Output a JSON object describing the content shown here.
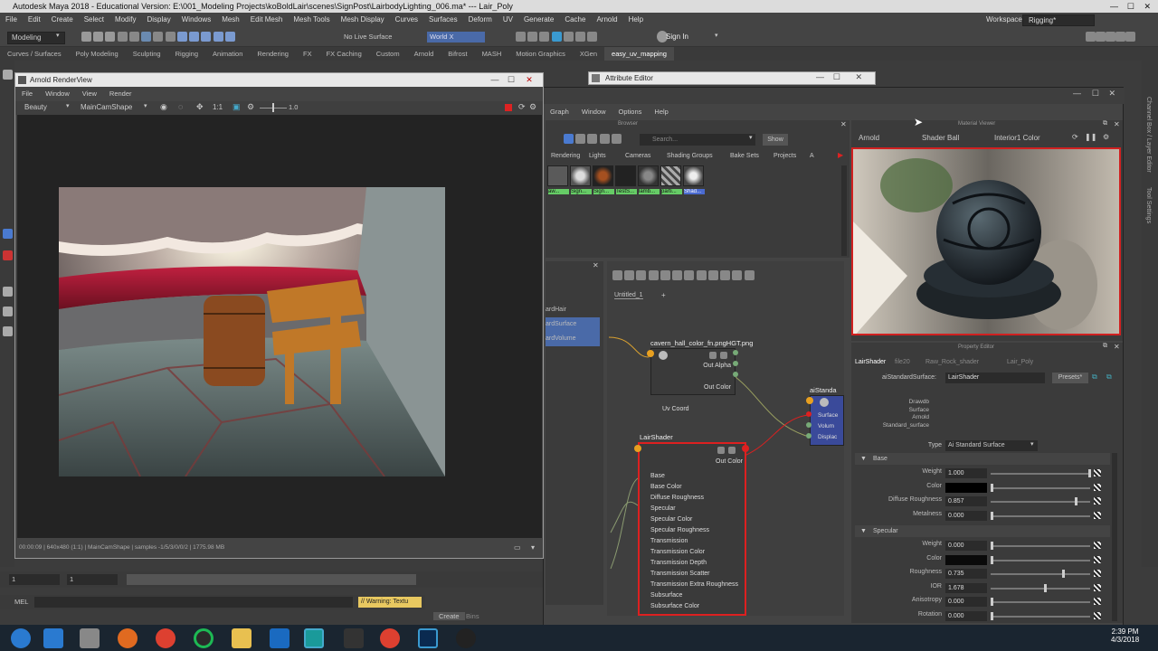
{
  "title_bar": {
    "text": "Autodesk Maya 2018 - Educational Version: E:\\001_Modeling Projects\\koBoldLair\\scenes\\SignPost\\LairbodyLighting_006.ma* --- Lair_Poly"
  },
  "menubar": [
    "File",
    "Edit",
    "Create",
    "Select",
    "Modify",
    "Display",
    "Windows",
    "Mesh",
    "Edit Mesh",
    "Mesh Tools",
    "Mesh Display",
    "Curves",
    "Surfaces",
    "Deform",
    "UV",
    "Generate",
    "Cache",
    "Arnold",
    "Help"
  ],
  "workspace": {
    "label": "Workspace :",
    "value": "Rigging*"
  },
  "toolbar": {
    "mode": "Modeling",
    "live_surface": "No Live Surface",
    "world": "World X",
    "sign_in": "Sign In"
  },
  "shelf_tabs": [
    "Curves / Surfaces",
    "Poly Modeling",
    "Sculpting",
    "Rigging",
    "Animation",
    "Rendering",
    "FX",
    "FX Caching",
    "Custom",
    "Arnold",
    "Bifrost",
    "MASH",
    "Motion Graphics",
    "XGen",
    "easy_uv_mapping"
  ],
  "shelf_active": "easy_uv_mapping",
  "render_view": {
    "title": "Arnold RenderView",
    "menu": [
      "File",
      "Window",
      "View",
      "Render"
    ],
    "aov": "Beauty",
    "camera": "MainCamShape",
    "ratio": "1:1",
    "exposure": "1.0",
    "status": "00:00:09 | 640x480 (1:1) | MainCamShape | samples -1/5/3/0/0/2 | 1775.98 MB"
  },
  "attribute_editor": {
    "title": "Attribute Editor"
  },
  "hypershade": {
    "menu": [
      "Graph",
      "Window",
      "Options",
      "Help"
    ],
    "browser_label": "Browser",
    "search_placeholder": "Search...",
    "show_button": "Show",
    "tabs": [
      "Rendering",
      "Lights",
      "Cameras",
      "Shading Groups",
      "Bake Sets",
      "Projects",
      "A"
    ],
    "swatches": [
      "aw...",
      "Sign...",
      "Sign...",
      "TestS...",
      "lamb...",
      "parti...",
      "Shad..."
    ],
    "side_items": [
      "ardHair",
      "ardSurface",
      "ardVolume"
    ],
    "graph_tab": "Untitled_1",
    "bottom_tabs": [
      "Create",
      "Bins"
    ]
  },
  "file_node": {
    "title": "cavern_hall_color_fn.pngHGT.png",
    "ports": [
      "Out Alpha",
      "Out Color",
      "Uv Coord"
    ]
  },
  "lair_node": {
    "title": "LairShader",
    "out": "Out Color",
    "ports": [
      "Base",
      "Base Color",
      "Diffuse Roughness",
      "Specular",
      "Specular Color",
      "Specular Roughness",
      "Transmission",
      "Transmission Color",
      "Transmission Depth",
      "Transmission Scatter",
      "Transmission Extra Roughness",
      "Subsurface",
      "Subsurface Color"
    ]
  },
  "ai_node": {
    "title": "aiStanda",
    "ports": [
      "Surface",
      "Volum",
      "Displac"
    ]
  },
  "material_viewer": {
    "label": "Material Viewer",
    "renderer": "Arnold",
    "geometry": "Shader Ball",
    "env": "Interior1 Color"
  },
  "property_editor": {
    "label": "Property Editor",
    "tabs": [
      "LairShader",
      "file20",
      "Raw_Rock_shader",
      "Lair_Poly"
    ],
    "node_label": "aiStandardSurface:",
    "node_name": "LairShader",
    "presets": "Presets*",
    "drawdb": [
      "Drawdb",
      "Surface",
      "Arnold",
      "Standard_surface"
    ],
    "type_label": "Type",
    "type_value": "Ai Standard Surface",
    "sections": [
      {
        "name": "Base",
        "rows": [
          {
            "label": "Weight",
            "value": "1.000",
            "level": 1.0
          },
          {
            "label": "Color",
            "value": "",
            "swatch": "#000000"
          },
          {
            "label": "Diffuse Roughness",
            "value": "0.857",
            "level": 0.857
          },
          {
            "label": "Metalness",
            "value": "0.000",
            "level": 0.0
          }
        ]
      },
      {
        "name": "Specular",
        "rows": [
          {
            "label": "Weight",
            "value": "0.000",
            "level": 0.0
          },
          {
            "label": "Color",
            "value": "",
            "swatch": "#0a0a0a"
          },
          {
            "label": "Roughness",
            "value": "0.735",
            "level": 0.735
          },
          {
            "label": "IOR",
            "value": "1.678",
            "level": 0.55
          },
          {
            "label": "Anisotropy",
            "value": "0.000",
            "level": 0.0
          },
          {
            "label": "Rotation",
            "value": "0.000",
            "level": 0.0
          }
        ]
      }
    ]
  },
  "timeline": {
    "start": "1",
    "current": "1",
    "warning": "// Warning: Textu"
  },
  "command_line": {
    "label": "MEL"
  },
  "right_strip": [
    "Channel Box / Layer Editor",
    "Tool Settings"
  ],
  "taskbar": {
    "time": "2:39 PM",
    "date": "4/3/2018"
  },
  "colors": {
    "accent_red": "#e02030",
    "node_highlight": "#dd2020",
    "viewer_border": "#d02020"
  }
}
